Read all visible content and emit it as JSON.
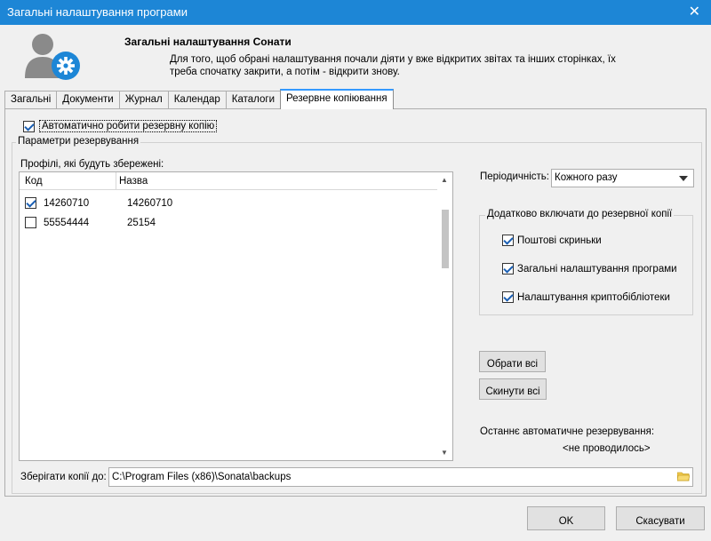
{
  "window": {
    "title": "Загальні налаштування програми",
    "close_glyph": "✕"
  },
  "header": {
    "title": "Загальні налаштування Сонати",
    "description": "Для того, щоб обрані налаштування почали діяти у вже відкритих звітах та інших сторінках, їх треба спочатку закрити, а потім - відкрити знову.",
    "icon": "user-settings-icon"
  },
  "tabs": [
    {
      "label": "Загальні",
      "active": false
    },
    {
      "label": "Документи",
      "active": false
    },
    {
      "label": "Журнал",
      "active": false
    },
    {
      "label": "Календар",
      "active": false
    },
    {
      "label": "Каталоги",
      "active": false
    },
    {
      "label": "Резервне копіювання",
      "active": true
    }
  ],
  "backup": {
    "auto_backup_label": "Автоматично робити резервну копію",
    "auto_backup_checked": true,
    "group_title": "Параметри резервування",
    "profiles_label": "Профілі, які будуть збережені:",
    "grid": {
      "columns": [
        "Код",
        "Назва"
      ],
      "rows": [
        {
          "code": "14260710",
          "name": "14260710",
          "checked": true
        },
        {
          "code": "55554444",
          "name": "25154",
          "checked": false
        }
      ]
    },
    "period_label": "Періодичність:",
    "period_value": "Кожного разу",
    "extra_group_title": "Додатково включати до резервної копії",
    "extra_items": [
      {
        "label": "Поштові скриньки",
        "checked": true
      },
      {
        "label": "Загальні налаштування програми",
        "checked": true
      },
      {
        "label": "Налаштування криптобібліотеки",
        "checked": true
      }
    ],
    "select_all_label": "Обрати всі",
    "reset_all_label": "Скинути всі",
    "last_backup_label": "Останнє автоматичне резервування:",
    "last_backup_value": "<не проводилось>",
    "save_to_label": "Зберігати копії до:",
    "save_to_path": "C:\\Program Files (x86)\\Sonata\\backups"
  },
  "footer": {
    "ok_label": "OK",
    "cancel_label": "Скасувати"
  },
  "colors": {
    "titlebar": "#1d86d6",
    "active_tab_accent": "#3399ff",
    "gear_badge": "#1d86d6",
    "user_silhouette": "#8a8a8a",
    "folder": "#f2c94c"
  }
}
